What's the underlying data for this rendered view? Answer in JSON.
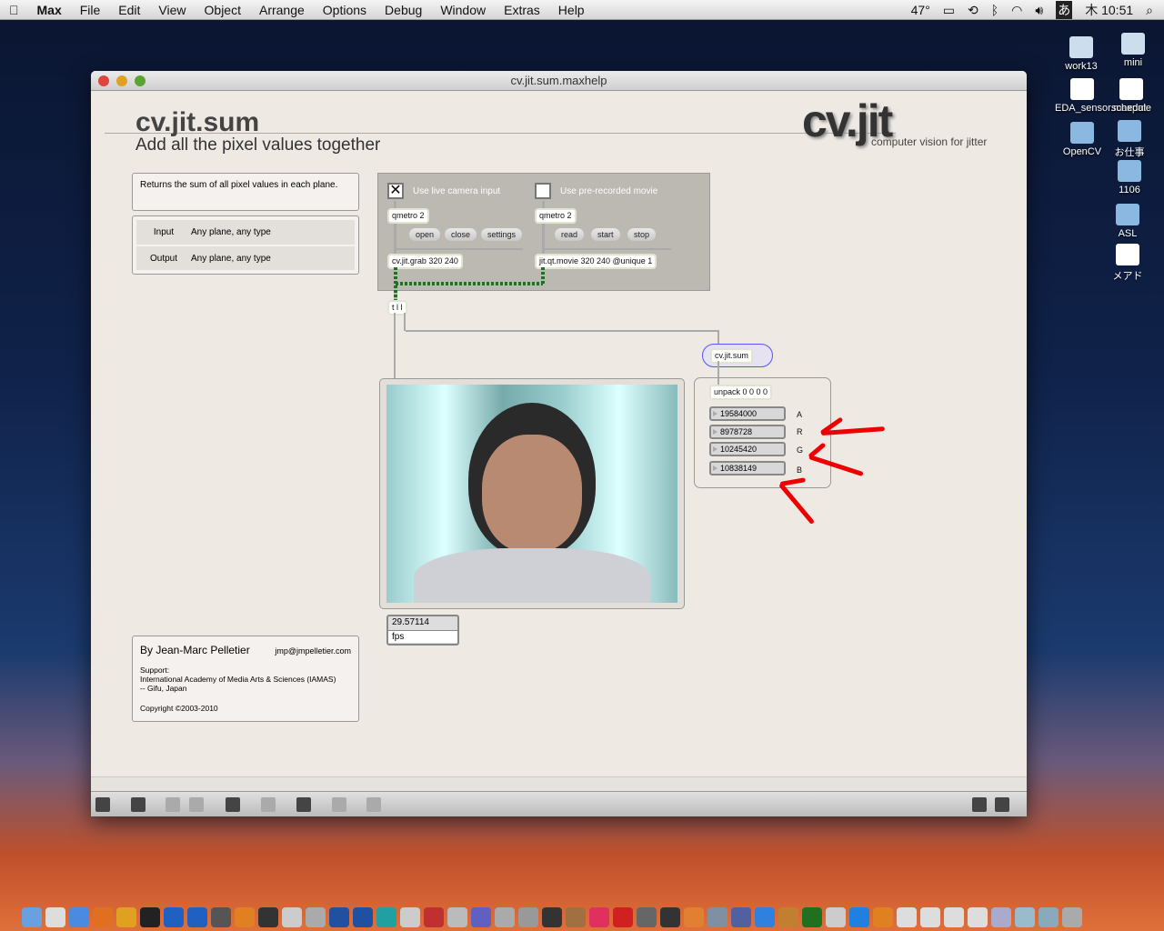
{
  "menubar": {
    "app": "Max",
    "items": [
      "File",
      "Edit",
      "View",
      "Object",
      "Arrange",
      "Options",
      "Debug",
      "Window",
      "Extras",
      "Help"
    ],
    "temp": "47°",
    "input": "あ",
    "clock": "木 10:51"
  },
  "desktop": [
    "work13",
    "mini",
    "EDA_sensor.maxpat",
    "schedule",
    "OpenCV",
    "お仕事",
    "1106",
    "ASL",
    "メアド"
  ],
  "window": {
    "title": "cv.jit.sum.maxhelp"
  },
  "header": {
    "title": "cv.jit.sum",
    "subtitle": "Add all the pixel values together",
    "logo": "cv.jit",
    "logo_sub": "computer vision for jitter"
  },
  "info": {
    "desc": "Returns the sum of all pixel values in each plane.",
    "rows": [
      {
        "k": "Input",
        "v": "Any plane, any type"
      },
      {
        "k": "Output",
        "v": "Any plane, any type"
      }
    ]
  },
  "patch": {
    "live_label": "Use live camera input",
    "movie_label": "Use pre-recorded movie",
    "live_checked": true,
    "movie_checked": false,
    "qmetro1": "qmetro 2",
    "qmetro2": "qmetro 2",
    "open": "open",
    "close": "close",
    "settings": "settings",
    "read": "read",
    "start": "start",
    "stop": "stop",
    "grab": "cv.jit.grab 320 240",
    "movie": "jit.qt.movie 320 240 @unique 1",
    "trigger": "t l l",
    "sum": "cv.jit.sum",
    "unpack": "unpack 0 0 0 0",
    "values": [
      {
        "v": "19584000",
        "l": "A"
      },
      {
        "v": "8978728",
        "l": "R"
      },
      {
        "v": "10245420",
        "l": "G"
      },
      {
        "v": "10838149",
        "l": "B"
      }
    ],
    "fps_value": "29.57114",
    "fps_label": "fps"
  },
  "credits": {
    "author": "By Jean-Marc Pelletier",
    "email": "jmp@jmpelletier.com",
    "support": "Support:",
    "org": "International Academy of Media Arts & Sciences (IAMAS)",
    "place": "-- Gifu, Japan",
    "copyright": "Copyright ©2003-2010"
  }
}
